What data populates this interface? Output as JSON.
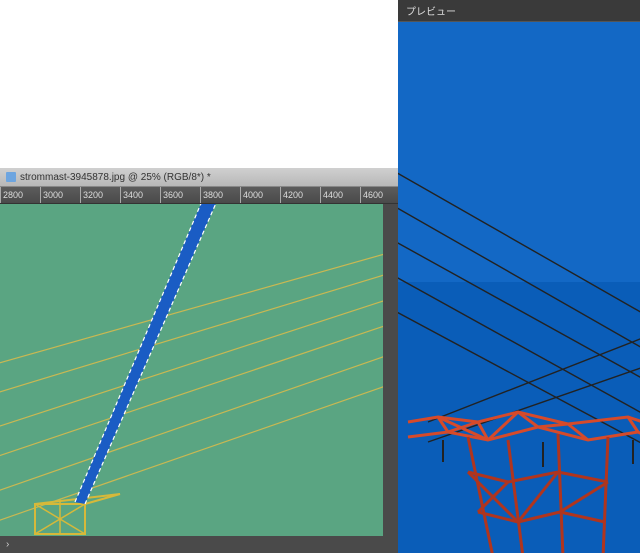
{
  "document": {
    "tab_label": "strommast-3945878.jpg @ 25% (RGB/8*) *",
    "zoom": "25%",
    "color_mode": "RGB/8*"
  },
  "ruler": {
    "ticks": [
      "2800",
      "3000",
      "3200",
      "3400",
      "3600",
      "3800",
      "4000",
      "4200",
      "4400",
      "4600"
    ]
  },
  "preview": {
    "header_label": "プレビュー"
  },
  "colors": {
    "mask_overlay": "#5aa582",
    "sky_blue": "#0a5db8",
    "pylon_red": "#d64a2a",
    "pylon_yellow": "#d6b93a"
  }
}
